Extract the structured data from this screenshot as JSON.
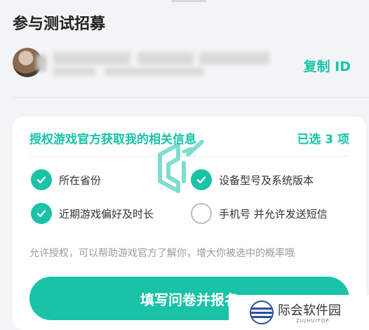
{
  "page": {
    "title": "参与测试招募"
  },
  "profile": {
    "copy_id_label": "复制 ID"
  },
  "authorization_card": {
    "heading": "授权游戏官方获取我的相关信息",
    "selected_count": "已选 3 项",
    "options": [
      {
        "label": "所在省份",
        "checked": true
      },
      {
        "label": "设备型号及系统版本",
        "checked": true
      },
      {
        "label": "近期游戏偏好及时长",
        "checked": true
      },
      {
        "label": "手机号 并允许发送短信",
        "checked": false
      }
    ],
    "note": "允许授权，可以帮助游戏官方了解你，增大你被选中的概率哦",
    "submit_label": "填写问卷并报名"
  },
  "watermark": {
    "name": "际会软件园",
    "sub": "ZUJHUITOP"
  },
  "colors": {
    "accent": "#18c3a8",
    "background": "#f3f4f6",
    "card": "#ffffff",
    "muted_text": "#9a9a9a"
  }
}
